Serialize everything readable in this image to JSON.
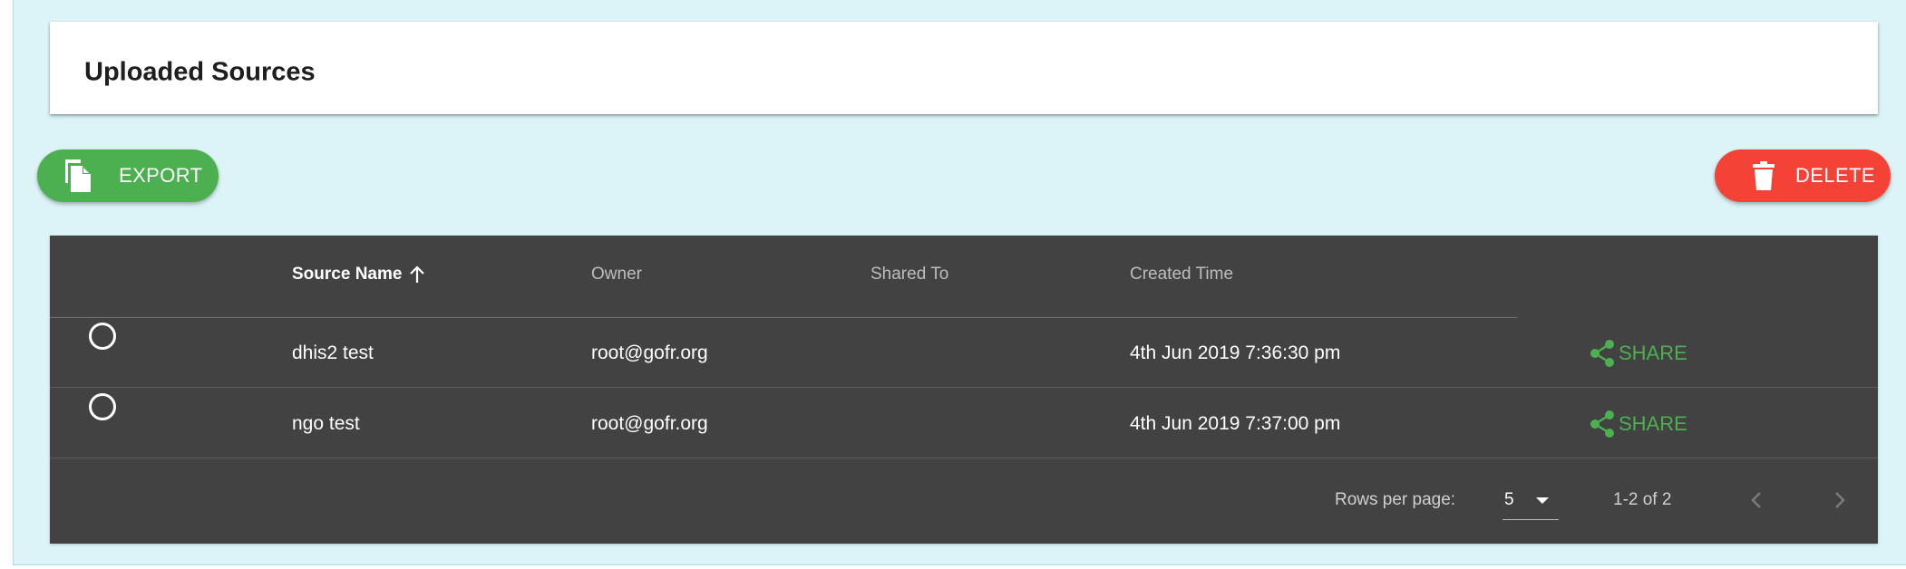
{
  "page": {
    "title": "Uploaded Sources"
  },
  "actions": {
    "export_label": "EXPORT",
    "delete_label": "DELETE"
  },
  "table": {
    "columns": [
      "Source Name",
      "Owner",
      "Shared To",
      "Created Time"
    ],
    "sorted_column": "Source Name",
    "sort_direction": "ascending",
    "rows": [
      {
        "source_name": "dhis2 test",
        "owner": "root@gofr.org",
        "shared_to": "",
        "created_time": "4th Jun 2019 7:36:30 pm",
        "action_label": "SHARE"
      },
      {
        "source_name": "ngo test",
        "owner": "root@gofr.org",
        "shared_to": "",
        "created_time": "4th Jun 2019 7:37:00 pm",
        "action_label": "SHARE"
      }
    ]
  },
  "pagination": {
    "rows_per_page_label": "Rows per page:",
    "rows_per_page_value": "5",
    "range_text": "1-2 of 2"
  },
  "colors": {
    "page_background": "#dcf4f7",
    "export_button": "#4caf50",
    "delete_button": "#f44336",
    "table_background": "#424242",
    "share_link": "#4caf50"
  },
  "icons": {
    "export": "file-copy-icon",
    "delete": "trash-icon",
    "share": "share-icon",
    "sort": "arrow-up-icon",
    "dropdown": "caret-down-icon",
    "prev": "chevron-left-icon",
    "next": "chevron-right-icon"
  }
}
